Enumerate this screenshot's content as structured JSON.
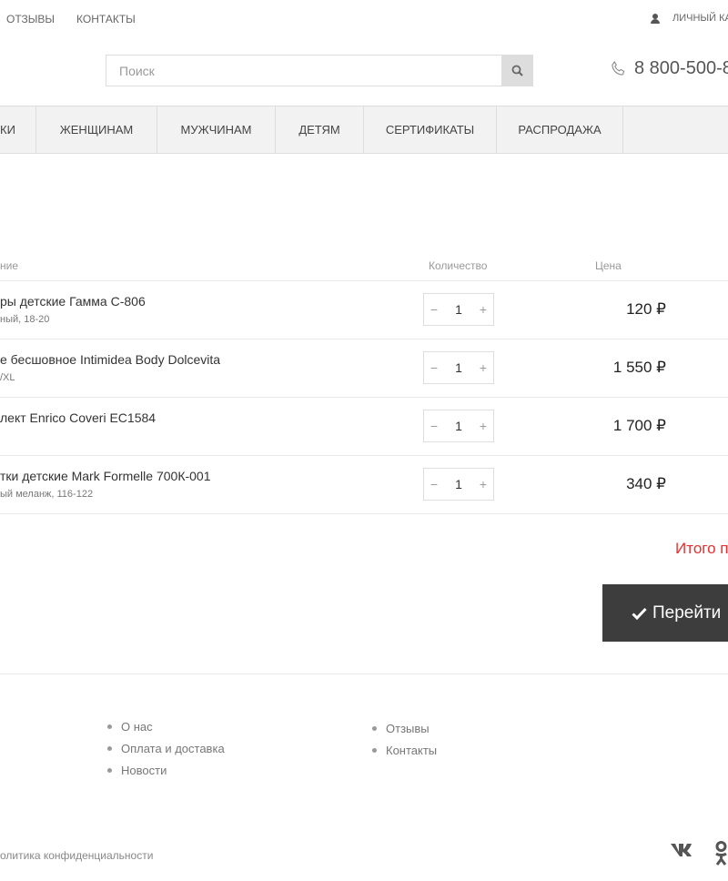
{
  "top_links": [
    "ОТЗЫВЫ",
    "КОНТАКТЫ"
  ],
  "account_label": "ЛИЧНЫЙ КА",
  "search": {
    "placeholder": "Поиск"
  },
  "phone": "8 800-500-8",
  "nav": [
    "КИ",
    "ЖЕНЩИНАМ",
    "МУЖЧИНАМ",
    "ДЕТЯМ",
    "СЕРТИФИКАТЫ",
    "РАСПРОДАЖА"
  ],
  "cart": {
    "headers": {
      "name": "ние",
      "quantity": "Количество",
      "price": "Цена"
    },
    "items": [
      {
        "name": "ры детские Гамма С-806",
        "variant": "ный, 18-20",
        "qty": "1",
        "price": "120 ₽"
      },
      {
        "name": "е бесшовное Intimidea Body Dolcevita",
        "variant": "/XL",
        "qty": "1",
        "price": "1 550 ₽"
      },
      {
        "name": "лект Enrico Coveri EC1584",
        "variant": "",
        "qty": "1",
        "price": "1 700 ₽"
      },
      {
        "name": "тки детские Mark Formelle 700К-001",
        "variant": "ый меланж, 116-122",
        "qty": "1",
        "price": "340 ₽"
      }
    ],
    "total_label": "Итого п",
    "checkout_label": "Перейти"
  },
  "footer": {
    "col1": [
      "О нас",
      "Оплата и доставка",
      "Новости"
    ],
    "col2": [
      "Отзывы",
      "Контакты"
    ],
    "privacy": "олитика конфиденциальности"
  }
}
